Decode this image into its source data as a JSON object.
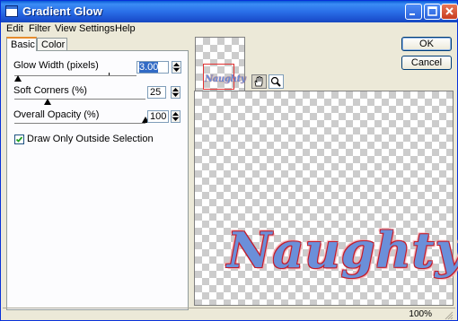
{
  "window": {
    "title": "Gradient Glow"
  },
  "menu": [
    "Edit",
    "Filter",
    "View",
    "Settings",
    "Help"
  ],
  "tabs": {
    "basic": "Basic",
    "color": "Color"
  },
  "controls": {
    "glow_width": {
      "label": "Glow Width (pixels)",
      "value": "3.00",
      "slider_fraction": 0.03
    },
    "soft_corners": {
      "label": "Soft Corners (%)",
      "value": "25",
      "slider_fraction": 0.25
    },
    "overall_opacity": {
      "label": "Overall Opacity (%)",
      "value": "100",
      "slider_fraction": 1.0
    },
    "draw_only_outside": {
      "label": "Draw Only Outside Selection",
      "checked": true
    }
  },
  "buttons": {
    "ok": "OK",
    "cancel": "Cancel"
  },
  "preview": {
    "word": "Naughty",
    "thumb_word": "Naughty"
  },
  "tools": {
    "pan": "hand-icon",
    "zoom": "magnifier-icon"
  },
  "status": {
    "zoom": "100%"
  },
  "colors": {
    "title_bar": "#2a6fe8",
    "text_fill": "#6b8fd9",
    "glow_outline": "#c41e2e",
    "tab_highlight": "#e68b2c"
  }
}
